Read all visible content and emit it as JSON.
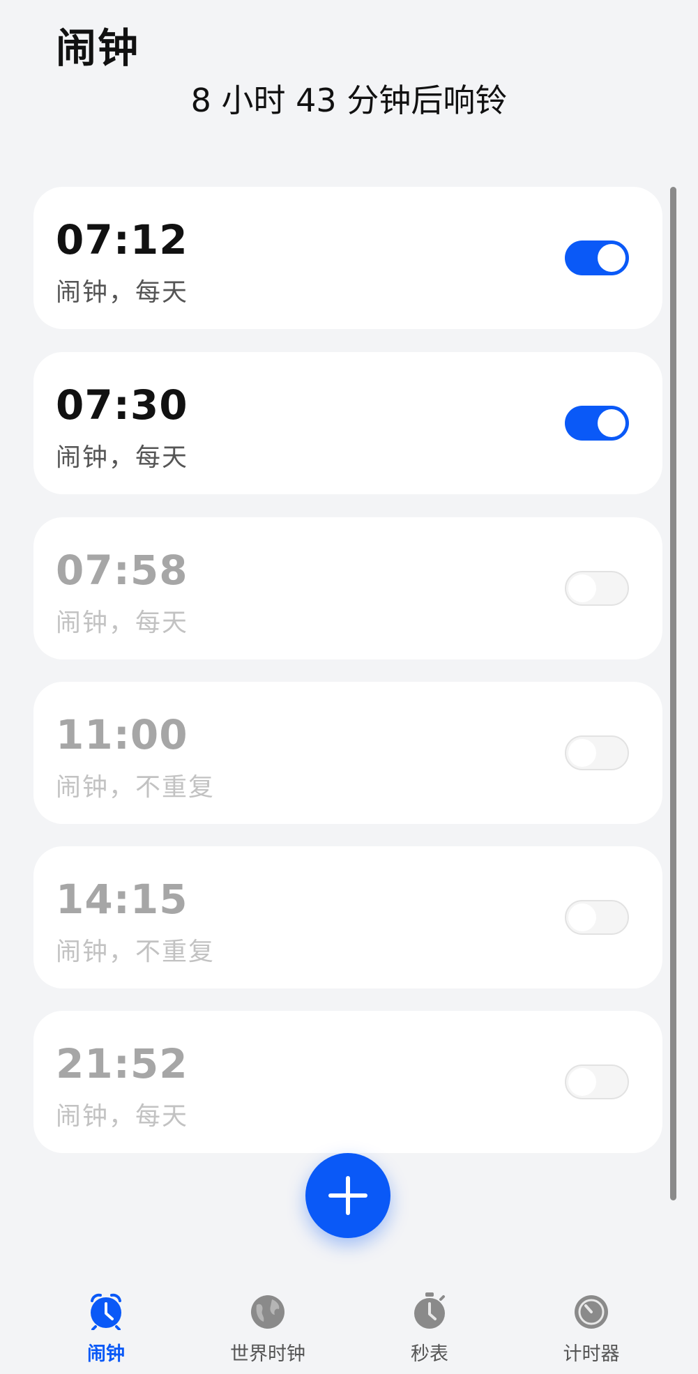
{
  "header": {
    "title": "闹钟",
    "countdown": "8 小时 43 分钟后响铃"
  },
  "alarms": [
    {
      "time": "07:12",
      "label": "闹钟，每天",
      "enabled": true
    },
    {
      "time": "07:30",
      "label": "闹钟，每天",
      "enabled": true
    },
    {
      "time": "07:58",
      "label": "闹钟，每天",
      "enabled": false
    },
    {
      "time": "11:00",
      "label": "闹钟，不重复",
      "enabled": false
    },
    {
      "time": "14:15",
      "label": "闹钟，不重复",
      "enabled": false
    },
    {
      "time": "21:52",
      "label": "闹钟，每天",
      "enabled": false
    }
  ],
  "fab": {
    "icon": "plus-icon"
  },
  "bottom_nav": [
    {
      "label": "闹钟",
      "icon": "alarm-clock-icon",
      "active": true
    },
    {
      "label": "世界时钟",
      "icon": "globe-icon",
      "active": false
    },
    {
      "label": "秒表",
      "icon": "stopwatch-icon",
      "active": false
    },
    {
      "label": "计时器",
      "icon": "timer-icon",
      "active": false
    }
  ],
  "colors": {
    "accent": "#0a59f7",
    "background": "#f3f4f6",
    "inactive_icon": "#8a8a8a"
  }
}
